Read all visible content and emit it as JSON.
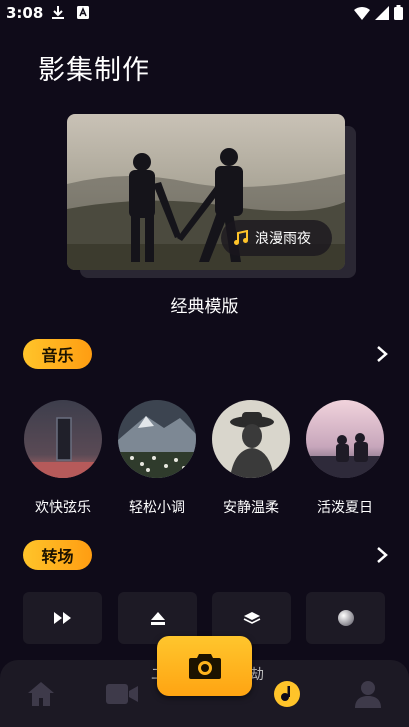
{
  "status": {
    "time": "3:08"
  },
  "title": "影集制作",
  "template": {
    "music_chip": "浪漫雨夜",
    "caption": "经典模版"
  },
  "music_section": {
    "label": "音乐",
    "items": [
      {
        "label": "欢快弦乐"
      },
      {
        "label": "轻松小调"
      },
      {
        "label": "安静温柔"
      },
      {
        "label": "活泼夏日"
      }
    ]
  },
  "transition_section": {
    "label": "转场",
    "items": [
      {
        "icon": "fast-forward-icon"
      },
      {
        "icon": "eject-icon"
      },
      {
        "icon": "layers-icon"
      },
      {
        "icon": "sphere-icon"
      }
    ]
  },
  "tab_bar": {
    "items": [
      "home-icon",
      "video-camera-icon",
      "music-note-icon",
      "person-icon"
    ],
    "active_color": "#ffc42a"
  },
  "colors": {
    "accent": "#ffc42a",
    "background": "#0f0b19"
  }
}
